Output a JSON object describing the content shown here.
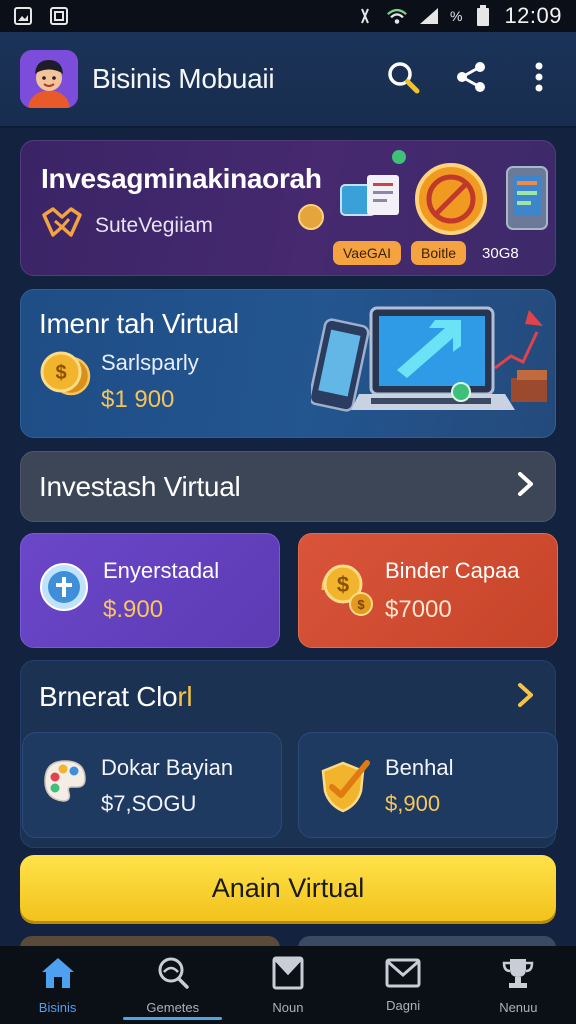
{
  "status_bar": {
    "pct": "%",
    "time": "12:09"
  },
  "app_bar": {
    "title": "Bisinis Mobuaii"
  },
  "hero": {
    "title": "Invesagminakinaorah",
    "subtitle": "SuteVegiiam",
    "tags": [
      "VaeGAI",
      "Boitle",
      "30G8"
    ]
  },
  "promo": {
    "title": "Imenr tah Virtual",
    "subtitle": "Sarlsparly",
    "amount": "$1 900"
  },
  "banner": {
    "title": "Investash Virtual"
  },
  "tiles": [
    {
      "label": "Enyerstadal",
      "value": "$.900",
      "icon": "plus-coin-icon"
    },
    {
      "label": "Binder Capaa",
      "value": "$7000",
      "icon": "dollar-coins-icon"
    }
  ],
  "section": {
    "title_main": "Brnerat Clo",
    "title_highlight": "rl",
    "items": [
      {
        "label": "Dokar Bayian",
        "value": "$7,SOGU",
        "icon": "palette-icon"
      },
      {
        "label": "Benhal",
        "value": "$,900",
        "icon": "shield-check-icon"
      }
    ]
  },
  "cta": {
    "label": "Anain Virtual"
  },
  "bottom_nav": [
    {
      "label": "Bisinis",
      "icon": "home-icon",
      "active": true
    },
    {
      "label": "Gemetes",
      "icon": "search-icon",
      "active": false
    },
    {
      "label": "Noun",
      "icon": "bookmark-icon",
      "active": false
    },
    {
      "label": "Dagni",
      "icon": "mail-icon",
      "active": false
    },
    {
      "label": "Nenuu",
      "icon": "trophy-icon",
      "active": false
    }
  ],
  "colors": {
    "background": "#13233f",
    "accent_gold": "#f5c34a",
    "hero_purple": "#46296f",
    "promo_blue": "#23558f",
    "tile_purple": "#6b47c9",
    "tile_red": "#d9543a",
    "cta_yellow": "#ffe34a",
    "nav_active": "#4ea0f0"
  }
}
